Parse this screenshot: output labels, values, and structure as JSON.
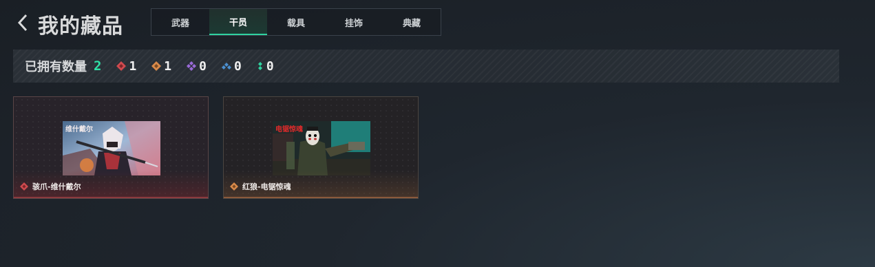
{
  "header": {
    "title": "我的藏品"
  },
  "tabs": [
    {
      "label": "武器",
      "active": false
    },
    {
      "label": "干员",
      "active": true
    },
    {
      "label": "载具",
      "active": false
    },
    {
      "label": "挂饰",
      "active": false
    },
    {
      "label": "典藏",
      "active": false
    }
  ],
  "stats": {
    "owned_label": "已拥有数量",
    "owned_count": "2",
    "rarities": [
      {
        "icon": "red-diamond-icon",
        "color": "#d04a4f",
        "count": "1"
      },
      {
        "icon": "orange-diamond-icon",
        "color": "#d98a4a",
        "count": "1"
      },
      {
        "icon": "purple-diamond-icon",
        "color": "#9a6ad8",
        "count": "0"
      },
      {
        "icon": "blue-diamond-icon",
        "color": "#4a8fd0",
        "count": "0"
      },
      {
        "icon": "green-diamond-icon",
        "color": "#2fd3a0",
        "count": "0"
      }
    ]
  },
  "cards": [
    {
      "name": "骇爪-维什戴尔",
      "rarity_color": "#d04a4f",
      "art_logo": "维什戴尔"
    },
    {
      "name": "红狼-电锯惊魂",
      "rarity_color": "#d98a4a",
      "art_logo": "电锯惊魂"
    }
  ],
  "colors": {
    "accent": "#2fd3a0"
  }
}
